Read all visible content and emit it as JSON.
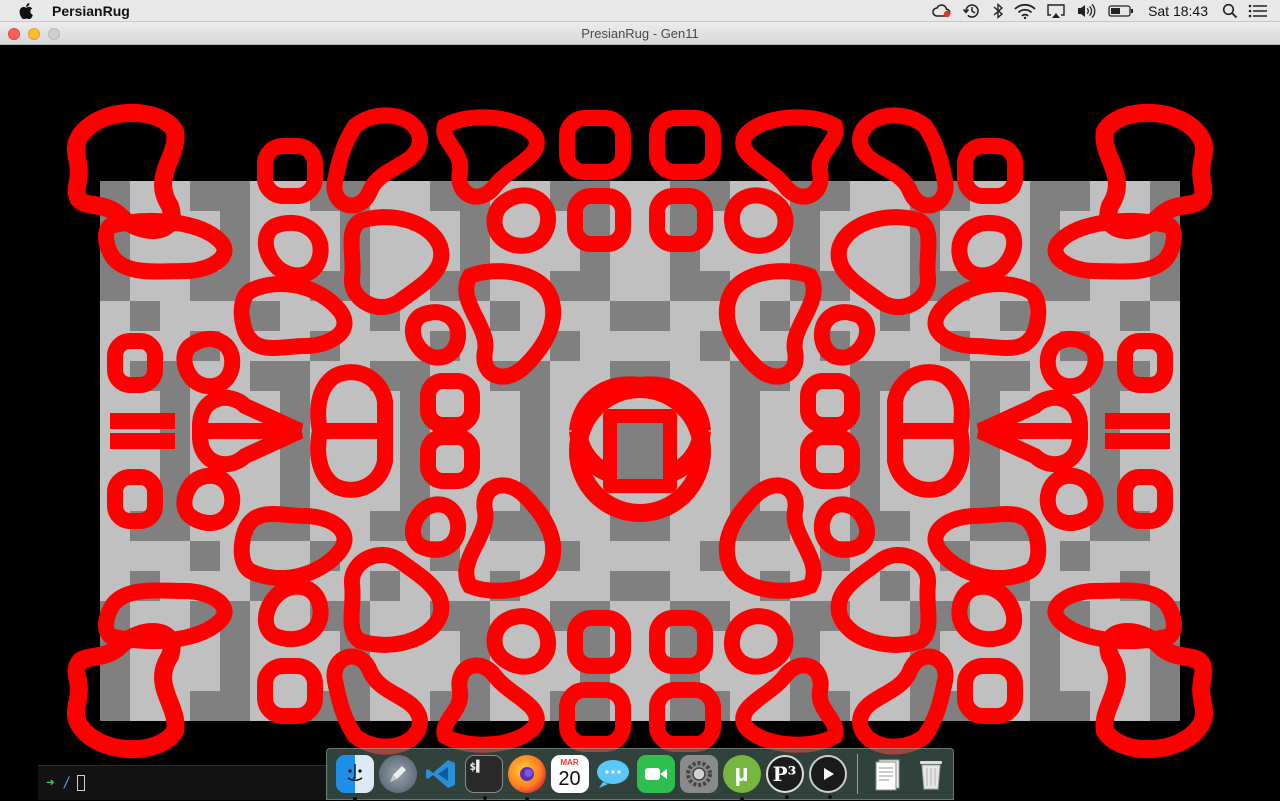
{
  "menubar": {
    "app_name": "PersianRug",
    "clock": "Sat 18:43",
    "icons": [
      "creative-cloud-icon",
      "time-machine-icon",
      "bluetooth-icon",
      "wifi-icon",
      "airplay-icon",
      "volume-icon",
      "battery-icon",
      "spotlight-search-icon",
      "notification-center-icon"
    ]
  },
  "window": {
    "title": "PresianRug - Gen11"
  },
  "rug": {
    "colors": {
      "ink": "#ff0000",
      "light": "#c0c0c0",
      "dark": "#808080",
      "background": "#000000"
    }
  },
  "terminal": {
    "prompt": "➜",
    "path": "/"
  },
  "dock": {
    "items": [
      {
        "name": "finder",
        "label": "Finder",
        "running": true
      },
      {
        "name": "launchpad",
        "label": "Launchpad",
        "running": false
      },
      {
        "name": "vscode",
        "label": "VS Code",
        "running": false
      },
      {
        "name": "terminal",
        "label": "Terminal",
        "running": true
      },
      {
        "name": "firefox",
        "label": "Firefox",
        "running": true
      },
      {
        "name": "calendar",
        "label": "Calendar",
        "month": "MAR",
        "day": "20",
        "running": false
      },
      {
        "name": "messages",
        "label": "Messages",
        "running": false
      },
      {
        "name": "facetime",
        "label": "FaceTime",
        "running": false
      },
      {
        "name": "system-preferences",
        "label": "System Preferences",
        "running": false
      },
      {
        "name": "utorrent",
        "label": "uTorrent",
        "running": true
      },
      {
        "name": "processing",
        "label": "Processing",
        "running": true
      },
      {
        "name": "quicktime",
        "label": "QuickTime",
        "running": true
      },
      {
        "name": "documents",
        "label": "Documents",
        "running": false
      },
      {
        "name": "trash",
        "label": "Trash",
        "running": false
      }
    ]
  }
}
